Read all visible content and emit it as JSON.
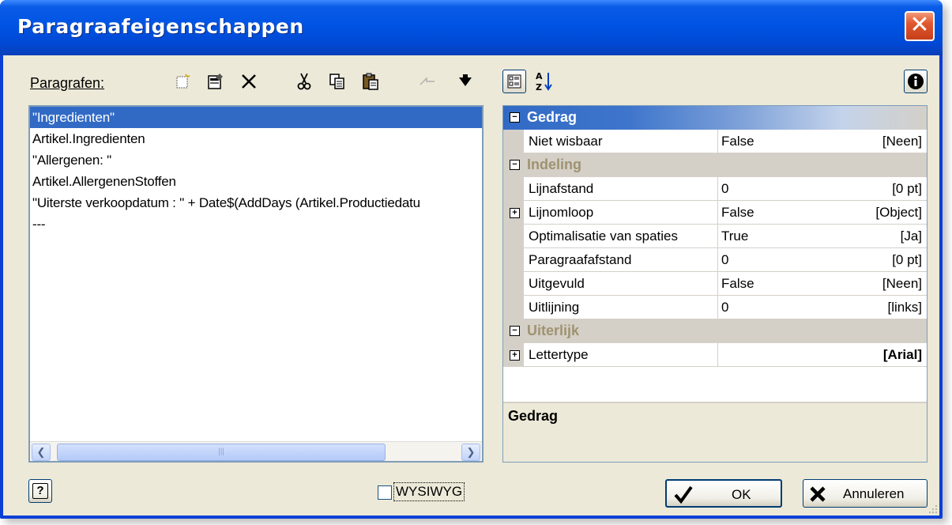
{
  "window": {
    "title": "Paragraafeigenschappen",
    "close_glyph": "✕"
  },
  "paragraphs": {
    "label": "Paragrafen:",
    "toolbar_icons": [
      "new-paragraph-icon",
      "properties-icon",
      "delete-icon",
      "cut-icon",
      "copy-icon",
      "paste-icon",
      "move-up-icon",
      "move-down-icon"
    ],
    "items": [
      "\"Ingredienten\"",
      "Artikel.Ingredienten",
      "\"Allergenen: \"",
      "Artikel.AllergenenStoffen",
      "\"Uiterste verkoopdatum : \" + Date$(AddDays (Artikel.Productiedatu",
      "---"
    ],
    "selected_index": 0,
    "scroll_thumb_glyph": "|||"
  },
  "property_grid": {
    "toolbar_icons": [
      "categorized-icon",
      "alphabetical-sort-icon"
    ],
    "info_icon": "info-icon",
    "categories": [
      {
        "name": "Gedrag",
        "active": true,
        "properties": [
          {
            "name": "Niet wisbaar",
            "value": "False",
            "display": "[Neen]",
            "expandable": false
          }
        ]
      },
      {
        "name": "Indeling",
        "active": false,
        "properties": [
          {
            "name": "Lijnafstand",
            "value": "0",
            "display": "[0 pt]",
            "expandable": false
          },
          {
            "name": "Lijnomloop",
            "value": "False",
            "display": "[Object]",
            "expandable": true
          },
          {
            "name": "Optimalisatie van spaties",
            "value": "True",
            "display": "[Ja]",
            "expandable": false
          },
          {
            "name": "Paragraafafstand",
            "value": "0",
            "display": "[0 pt]",
            "expandable": false
          },
          {
            "name": "Uitgevuld",
            "value": "False",
            "display": "[Neen]",
            "expandable": false
          },
          {
            "name": "Uitlijning",
            "value": "0",
            "display": "[links]",
            "expandable": false
          }
        ]
      },
      {
        "name": "Uiterlijk",
        "active": false,
        "properties": [
          {
            "name": "Lettertype",
            "value": "",
            "display": "[Arial]",
            "expandable": true,
            "bold_display": true
          }
        ]
      }
    ],
    "description_title": "Gedrag"
  },
  "footer": {
    "help_glyph": "?",
    "wysiwyg_label": "WYSIWYG",
    "wysiwyg_checked": false,
    "ok_label": "OK",
    "cancel_label": "Annuleren"
  },
  "colors": {
    "selection": "#316ac5",
    "category_text": "#a09270",
    "dialog_face": "#ece9d8",
    "titlebar": "#0054e3"
  }
}
